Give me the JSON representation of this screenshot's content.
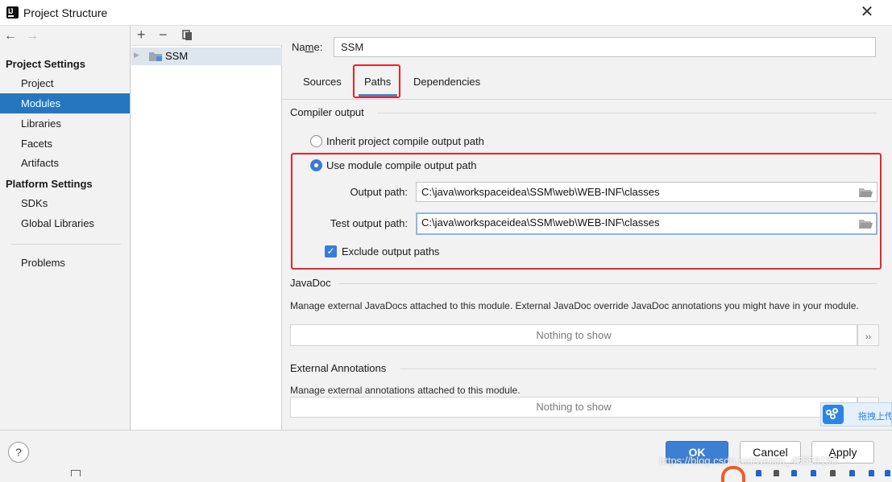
{
  "window": {
    "title": "Project Structure",
    "close": "✕"
  },
  "nav": {
    "back": "←",
    "forward": "→",
    "project_settings_header": "Project Settings",
    "project_settings_items": [
      "Project",
      "Modules",
      "Libraries",
      "Facets",
      "Artifacts"
    ],
    "platform_settings_header": "Platform Settings",
    "platform_settings_items": [
      "SDKs",
      "Global Libraries"
    ],
    "other_items": [
      "Problems"
    ],
    "selected": "Modules"
  },
  "tree": {
    "toolbar": {
      "add": "+",
      "remove": "−"
    },
    "modules": [
      "SSM"
    ]
  },
  "module": {
    "name_label_pre": "Na",
    "name_label_mnemonic": "m",
    "name_label_post": "e:",
    "name_value": "SSM"
  },
  "tabs": [
    "Sources",
    "Paths",
    "Dependencies"
  ],
  "active_tab": "Paths",
  "compiler_output": {
    "title": "Compiler output",
    "inherit_label": "Inherit project compile output path",
    "use_module_label": "Use module compile output path",
    "selected_option": "Use module compile output path",
    "output_path_label": "Output path:",
    "output_path_value": "C:\\java\\workspaceidea\\SSM\\web\\WEB-INF\\classes",
    "test_output_path_label": "Test output path:",
    "test_output_path_value": "C:\\java\\workspaceidea\\SSM\\web\\WEB-INF\\classes",
    "exclude_label": "Exclude output paths",
    "exclude_checked": true
  },
  "javadoc": {
    "title": "JavaDoc",
    "description": "Manage external JavaDocs attached to this module. External JavaDoc override JavaDoc annotations you might have in your module.",
    "empty_text": "Nothing to show",
    "more": "››"
  },
  "external_annotations": {
    "title": "External Annotations",
    "description": "Manage external annotations attached to this module.",
    "empty_text": "Nothing to show"
  },
  "buttons": {
    "help": "?",
    "ok": "OK",
    "cancel": "Cancel",
    "apply_mnemonic": "A",
    "apply_rest": "pply"
  },
  "overlay": {
    "baidu_text": "拖拽上传",
    "watermark": "https://blog.csdn.net/weixin_45659150"
  },
  "colors": {
    "accent": "#2675bf",
    "highlight_box": "#e8262a",
    "primary_button": "#3d80d3"
  }
}
